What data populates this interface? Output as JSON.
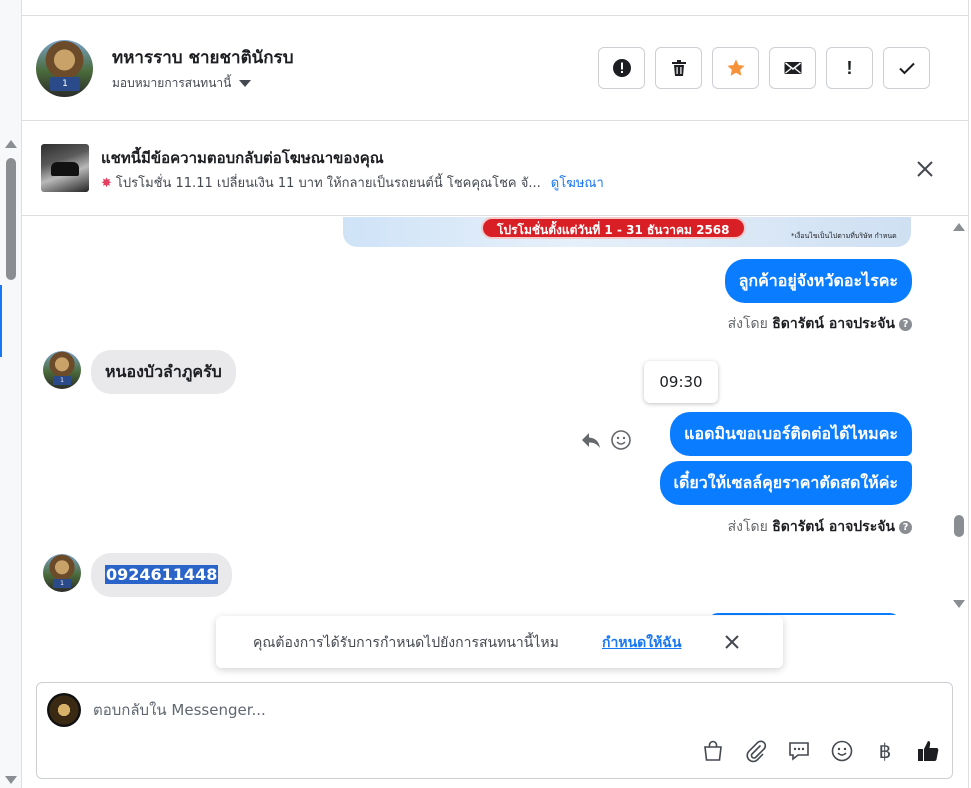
{
  "header": {
    "contact_name": "ทหารราบ ชายชาตินักรบ",
    "assign_label": "มอบหมายการสนทนานี้",
    "actions": [
      {
        "icon": "alert-circle-icon"
      },
      {
        "icon": "trash-icon"
      },
      {
        "icon": "star-icon",
        "color": "#f7923a"
      },
      {
        "icon": "mail-icon"
      },
      {
        "icon": "exclamation-icon",
        "label": "!"
      },
      {
        "icon": "check-icon"
      }
    ]
  },
  "ad_banner": {
    "title": "แชทนี้มีข้อความตอบกลับต่อโฆษณาของคุณ",
    "snippet": "โปรโมชั่น 11.11 เปลี่ยนเงิน 11 บาท ให้กลายเป็นรถยนต์นี้ โชคคุณโชค จั...",
    "link_label": "ดูโฆษณา"
  },
  "promo_image": {
    "pill_text": "โปรโมชั่นตั้งแต่วันที่ 1 - 31 ธันวาคม 2568",
    "fine_print": "*เงื่อนไขเป็นไปตามที่บริษัท กำหนด"
  },
  "messages": [
    {
      "direction": "out",
      "text": "ลูกค้าอยู่จังหวัดอะไรคะ"
    },
    {
      "type": "sent_by",
      "prefix": "ส่งโดย",
      "name": "ธิดารัตน์ อาจประจัน"
    },
    {
      "direction": "in",
      "text": "หนองบัวลำภูครับ"
    },
    {
      "type": "timestamp",
      "text": "09:30"
    },
    {
      "direction": "out",
      "text": "แอดมินขอเบอร์ติดต่อได้ไหมคะ"
    },
    {
      "direction": "out",
      "text": "เดี๋ยวให้เซลล์คุยราคาตัดสดให้ค่ะ"
    },
    {
      "type": "sent_by",
      "prefix": "ส่งโดย",
      "name": "ธิดารัตน์ อาจประจัน"
    },
    {
      "direction": "in",
      "text": "0924611448"
    }
  ],
  "toast": {
    "text": "คุณต้องการได้รับการกำหนดไปยังการสนทนานี้ไหม",
    "link_label": "กำหนดให้ฉัน"
  },
  "composer": {
    "placeholder": "ตอบกลับใน Messenger...",
    "tools": [
      "bag-icon",
      "paperclip-icon",
      "saved-reply-icon",
      "emoji-icon",
      "baht-icon",
      "thumbs-up-icon"
    ],
    "baht_symbol": "฿"
  },
  "colors": {
    "outgoing_bubble": "#0a7cff",
    "incoming_bubble": "#e9e9eb",
    "link": "#1877f2",
    "star": "#f7923a"
  }
}
